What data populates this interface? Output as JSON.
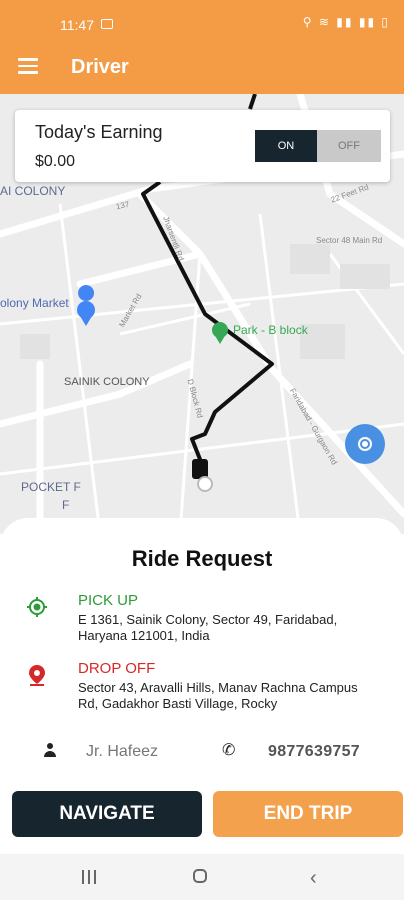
{
  "status": {
    "time": "11:47",
    "right_icons": "⚲ ≋ ▮▮ ▮▮ ▯"
  },
  "appbar": {
    "title": "Driver",
    "menu_icon": "hamburger-menu-icon"
  },
  "map": {
    "labels": {
      "colony_top": "AI COLONY",
      "market": "olony Market",
      "sainik": "SAINIK COLONY",
      "park": "Park - B block",
      "pocket_f": "POCKET F",
      "pocket_f2": "F",
      "road137": "137",
      "market_rd": "Market Rd",
      "dblock_rd": "D Block Rd",
      "faridabad_rd": "Faridabad - Gurgaon Rd",
      "sector48": "Sector 48 Main Rd",
      "feet_rd": "22 Feet Rd",
      "muni_rd": "Jharsentli Rd"
    },
    "colors": {
      "route": "#111111",
      "park_pin": "#34A853",
      "market_pin": "#4285F4",
      "locate_button": "#4A90E2"
    }
  },
  "earning": {
    "title": "Today's Earning",
    "value": "$0.00",
    "toggle_on": "ON",
    "toggle_off": "OFF"
  },
  "ride": {
    "title": "Ride Request",
    "pickup_label": "PICK UP",
    "pickup_address": "E 1361, Sainik Colony, Sector 49, Faridabad, Haryana 121001, India",
    "dropoff_label": "DROP OFF",
    "dropoff_address": "Sector 43, Aravalli Hills, Manav Rachna Campus Rd, Gadakhor Basti Village, Rocky",
    "rider_name": "Jr. Hafeez",
    "rider_phone": "9877639757",
    "navigate_label": "NAVIGATE",
    "end_trip_label": "END TRIP",
    "colors": {
      "pickup": "#2E9B3A",
      "dropoff": "#D62828",
      "navigate_bg": "#17262E",
      "end_trip_bg": "#F3A14D"
    }
  }
}
